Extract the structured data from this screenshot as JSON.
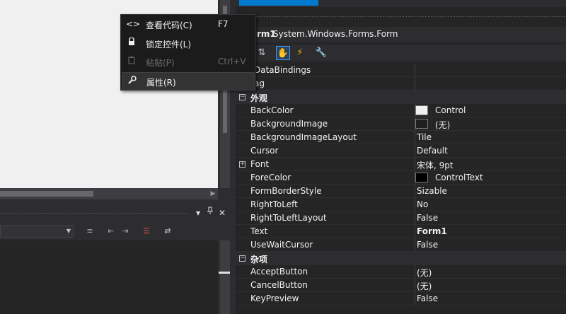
{
  "context_menu": {
    "items": [
      {
        "icon": "code-icon",
        "glyph": "<>",
        "label": "查看代码(C)",
        "shortcut": "F7",
        "enabled": true
      },
      {
        "icon": "lock-icon",
        "glyph": "🔒",
        "label": "锁定控件(L)",
        "shortcut": "",
        "enabled": true
      },
      {
        "icon": "paste-icon",
        "glyph": "📋",
        "label": "粘贴(P)",
        "shortcut": "Ctrl+V",
        "enabled": false
      },
      {
        "icon": "wrench-icon",
        "glyph": "🔧",
        "label": "属性(R)",
        "shortcut": "",
        "enabled": true
      }
    ]
  },
  "properties": {
    "object_name": "rm1",
    "object_type": "System.Windows.Forms.Form",
    "rows": [
      {
        "kind": "prop",
        "name": "DataBindings",
        "value": ""
      },
      {
        "kind": "prop",
        "name": "ag",
        "value": ""
      },
      {
        "kind": "category",
        "name": "外观"
      },
      {
        "kind": "prop",
        "name": "BackColor",
        "value": "Control",
        "swatch": "#f0f0f0"
      },
      {
        "kind": "prop",
        "name": "BackgroundImage",
        "value": "(无)",
        "swatch": "#1e1e1e"
      },
      {
        "kind": "prop",
        "name": "BackgroundImageLayout",
        "value": "Tile"
      },
      {
        "kind": "prop",
        "name": "Cursor",
        "value": "Default"
      },
      {
        "kind": "prop",
        "name": "Font",
        "value": "宋体, 9pt",
        "expandable": true
      },
      {
        "kind": "prop",
        "name": "ForeColor",
        "value": "ControlText",
        "swatch": "#000000"
      },
      {
        "kind": "prop",
        "name": "FormBorderStyle",
        "value": "Sizable"
      },
      {
        "kind": "prop",
        "name": "RightToLeft",
        "value": "No"
      },
      {
        "kind": "prop",
        "name": "RightToLeftLayout",
        "value": "False"
      },
      {
        "kind": "prop",
        "name": "Text",
        "value": "Form1",
        "bold": true
      },
      {
        "kind": "prop",
        "name": "UseWaitCursor",
        "value": "False"
      },
      {
        "kind": "category",
        "name": "杂项"
      },
      {
        "kind": "prop",
        "name": "AcceptButton",
        "value": "(无)"
      },
      {
        "kind": "prop",
        "name": "CancelButton",
        "value": "(无)"
      },
      {
        "kind": "prop",
        "name": "KeyPreview",
        "value": "False"
      }
    ]
  },
  "tool_window": {
    "pin_glyph": "📌",
    "close_glyph": "✕",
    "menu_glyph": "▾"
  }
}
